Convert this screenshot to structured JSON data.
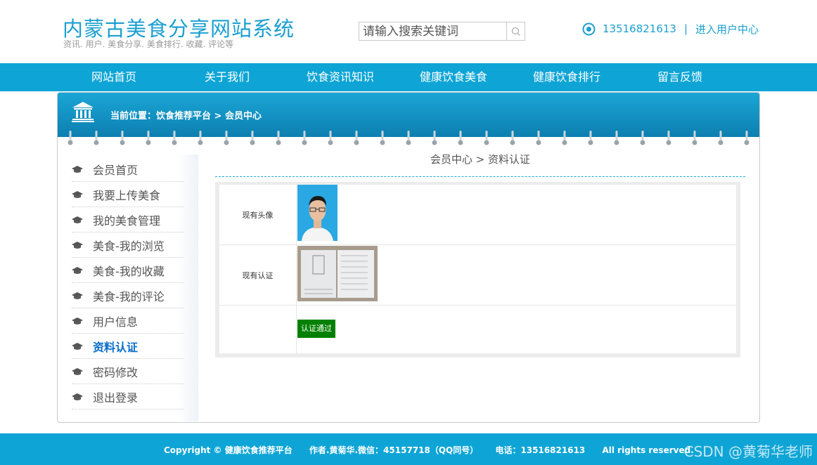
{
  "header": {
    "title": "内蒙古美食分享网站系统",
    "subtitle": "资讯. 用户. 美食分享. 美食排行. 收藏. 评论等",
    "search_placeholder": "请输入搜索关键词",
    "phone": "13516821613",
    "separator": "|",
    "user_center_link": "进入用户中心"
  },
  "nav": {
    "items": [
      "网站首页",
      "关于我们",
      "饮食资讯知识",
      "健康饮食美食",
      "健康饮食排行",
      "留言反馈"
    ]
  },
  "banner": {
    "location": "当前位置：饮食推荐平台 > 会员中心"
  },
  "sidebar": {
    "active_index": 7,
    "items": [
      "会员首页",
      "我要上传美食",
      "我的美食管理",
      "美食-我的浏览",
      "美食-我的收藏",
      "美食-我的评论",
      "用户信息",
      "资料认证",
      "密码修改",
      "退出登录"
    ]
  },
  "content": {
    "breadcrumb": "会员中心 > 资料认证",
    "avatar_label": "现有头像",
    "cert_label": "现有认证",
    "status_badge": "认证通过",
    "status_color": "#008000"
  },
  "footer": {
    "copyright": "Copyright © 健康饮食推荐平台",
    "author": "作者.黄菊华.微信：45157718（QQ同号）",
    "phone": "电话：13516821613",
    "rights": "All rights reserved.",
    "watermark": "CSDN @黄菊华老师"
  },
  "colors": {
    "brand": "#1a9fd0",
    "nav_bg": "#0ea5d6",
    "active_link": "#0b6fc9"
  }
}
